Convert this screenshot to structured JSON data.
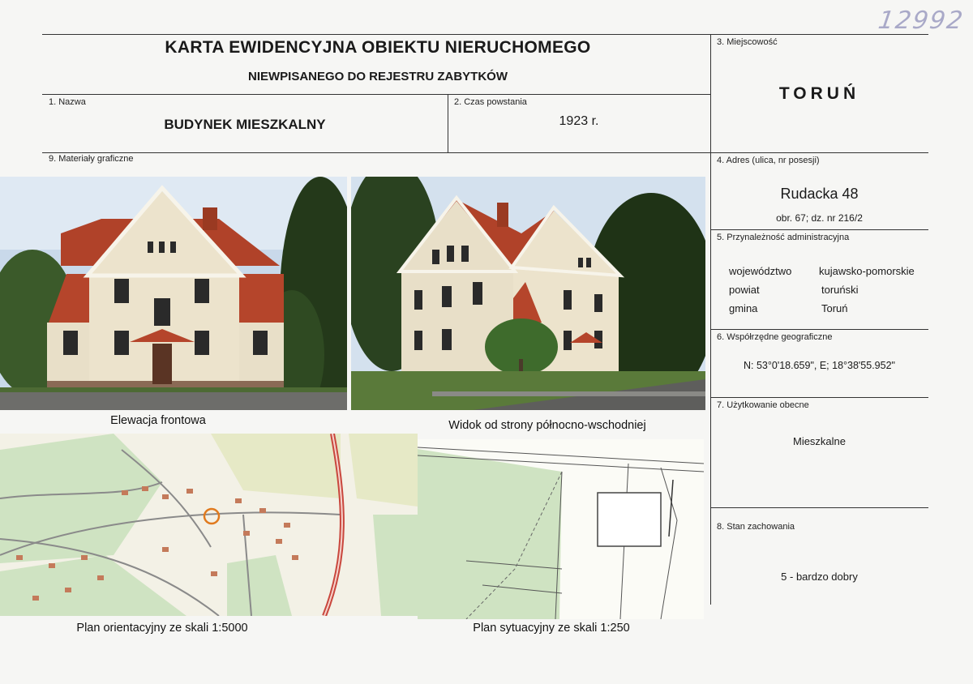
{
  "handwritten_number": "12992",
  "header": {
    "title": "KARTA EWIDENCYJNA OBIEKTU NIERUCHOMEGO",
    "subtitle": "NIEWPISANEGO DO REJESTRU ZABYTKÓW"
  },
  "fields": {
    "name": {
      "label": "1. Nazwa",
      "value": "BUDYNEK MIESZKALNY"
    },
    "period": {
      "label": "2. Czas powstania",
      "value": "1923 r."
    },
    "place": {
      "label": "3. Miejscowość",
      "value": "TORUŃ"
    },
    "address": {
      "label": "4. Adres (ulica, nr posesji)",
      "value": "Rudacka 48",
      "detail": "obr. 67; dz. nr 216/2"
    },
    "admin": {
      "label": "5. Przynależność administracyjna",
      "rows": [
        {
          "key": "województwo",
          "value": "kujawsko-pomorskie"
        },
        {
          "key": "powiat",
          "value": "toruński"
        },
        {
          "key": "gmina",
          "value": "Toruń"
        }
      ]
    },
    "coords": {
      "label": "6. Współrzędne geograficzne",
      "value": "N: 53°0'18.659\", E; 18°38'55.952\""
    },
    "usage": {
      "label": "7. Użytkowanie obecne",
      "value": "Mieszkalne"
    },
    "condition": {
      "label": "8. Stan zachowania",
      "value": "5 - bardzo dobry"
    },
    "graphics": {
      "label": "9. Materiały graficzne"
    }
  },
  "images": {
    "front": {
      "caption": "Elewacja frontowa"
    },
    "northeast": {
      "caption": "Widok od strony północno-wschodniej"
    },
    "map_orient": {
      "caption": "Plan orientacyjny ze skali 1:5000"
    },
    "map_site": {
      "caption": "Plan sytuacyjny ze skali 1:250"
    }
  },
  "colors": {
    "roof": "#b5452b",
    "wall": "#e8dfc8",
    "foliage": "#2f4a22",
    "map_green": "#cfe3c2",
    "road_red": "#c9473d"
  }
}
